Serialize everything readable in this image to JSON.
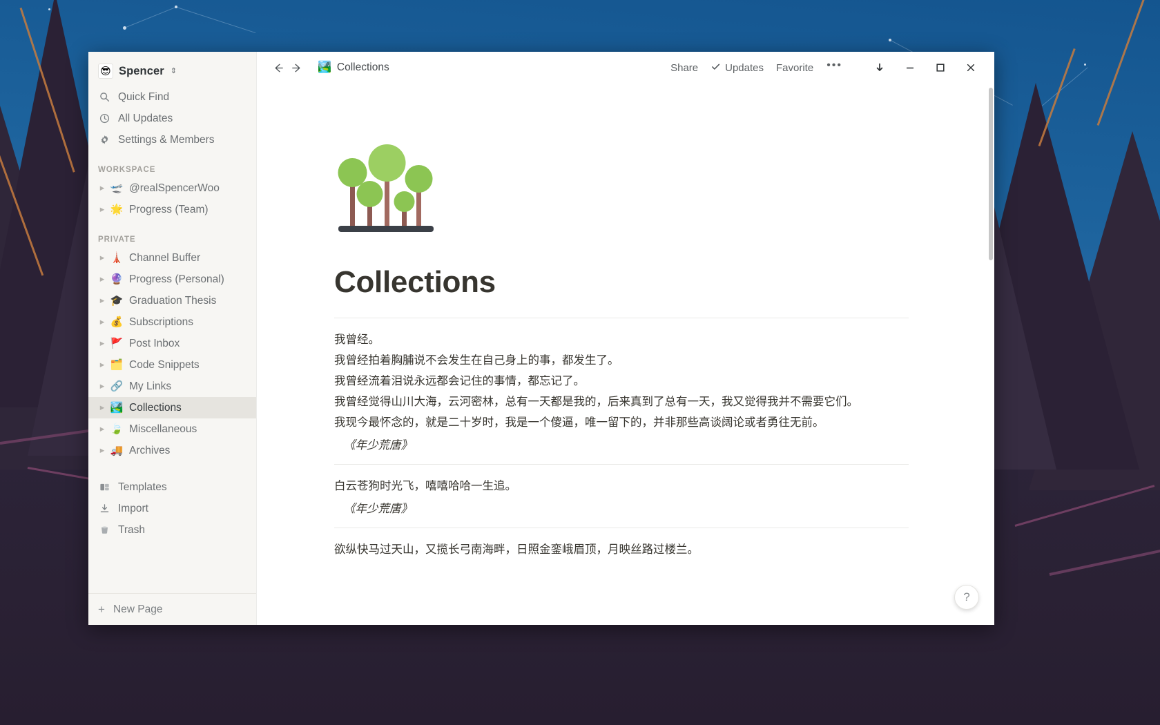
{
  "workspace": {
    "name": "Spencer",
    "avatar_icon": "sunglasses-face-emoji",
    "caret_icon": "chevron-updown-icon"
  },
  "sidebar": {
    "quick_items": [
      {
        "label": "Quick Find",
        "icon": "search-icon",
        "name": "quick-find"
      },
      {
        "label": "All Updates",
        "icon": "clock-icon",
        "name": "all-updates"
      },
      {
        "label": "Settings & Members",
        "icon": "gear-icon",
        "name": "settings-members"
      }
    ],
    "workspace_section": "WORKSPACE",
    "workspace_pages": [
      {
        "label": "@realSpencerWoo",
        "emoji": "🛫",
        "active": false
      },
      {
        "label": "Progress (Team)",
        "emoji": "🌟",
        "active": false
      }
    ],
    "private_section": "PRIVATE",
    "private_pages": [
      {
        "label": "Channel Buffer",
        "emoji": "🗼",
        "active": false
      },
      {
        "label": "Progress (Personal)",
        "emoji": "🔮",
        "active": false
      },
      {
        "label": "Graduation Thesis",
        "emoji": "🎓",
        "active": false
      },
      {
        "label": "Subscriptions",
        "emoji": "💰",
        "active": false
      },
      {
        "label": "Post Inbox",
        "emoji": "🚩",
        "active": false
      },
      {
        "label": "Code Snippets",
        "emoji": "🗂️",
        "active": false
      },
      {
        "label": "My Links",
        "emoji": "🔗",
        "active": false
      },
      {
        "label": "Collections",
        "emoji": "🏞️",
        "active": true
      },
      {
        "label": "Miscellaneous",
        "emoji": "🍃",
        "active": false
      },
      {
        "label": "Archives",
        "emoji": "🚚",
        "active": false
      }
    ],
    "util_items": [
      {
        "label": "Templates",
        "icon": "templates-icon",
        "name": "templates"
      },
      {
        "label": "Import",
        "icon": "import-icon",
        "name": "import"
      },
      {
        "label": "Trash",
        "icon": "trash-icon",
        "name": "trash"
      }
    ],
    "new_page_label": "New Page",
    "new_page_icon": "plus-icon"
  },
  "topbar": {
    "back_icon": "arrow-left-icon",
    "forward_icon": "arrow-right-icon",
    "breadcrumb_emoji": "🏞️",
    "breadcrumb_label": "Collections",
    "share_label": "Share",
    "updates_label": "Updates",
    "updates_icon": "check-icon",
    "favorite_label": "Favorite",
    "more_icon": "ellipsis-icon",
    "download_icon": "arrow-down-icon",
    "minimize_icon": "minimize-icon",
    "maximize_icon": "maximize-icon",
    "close_icon": "close-icon"
  },
  "page": {
    "icon": "national-park-emoji",
    "title": "Collections",
    "blocks": [
      {
        "type": "quote-block",
        "lines": [
          "我曾经。",
          "我曾经拍着胸脯说不会发生在自己身上的事，都发生了。",
          "我曾经流着泪说永远都会记住的事情，都忘记了。",
          "我曾经觉得山川大海，云河密林，总有一天都是我的，后来真到了总有一天，我又觉得我并不需要它们。",
          "我现今最怀念的，就是二十岁时，我是一个傻逼，唯一留下的，并非那些高谈阔论或者勇往无前。"
        ],
        "attribution": "《年少荒唐》"
      },
      {
        "type": "quote-block",
        "lines": [
          "白云苍狗时光飞，嘻嘻哈哈一生追。"
        ],
        "attribution": "《年少荒唐》"
      },
      {
        "type": "quote-block",
        "lines": [
          "欲纵快马过天山，又揽长弓南海畔，日照金銮峨眉顶，月映丝路过楼兰。"
        ],
        "attribution": ""
      }
    ]
  },
  "help": {
    "label": "?",
    "icon": "question-mark-icon"
  },
  "colors": {
    "sidebar_bg": "#f7f6f3",
    "active_item": "#e6e4df",
    "text": "#37352f",
    "muted_text": "#6b6f72",
    "accent_green": "#8bc34a"
  }
}
